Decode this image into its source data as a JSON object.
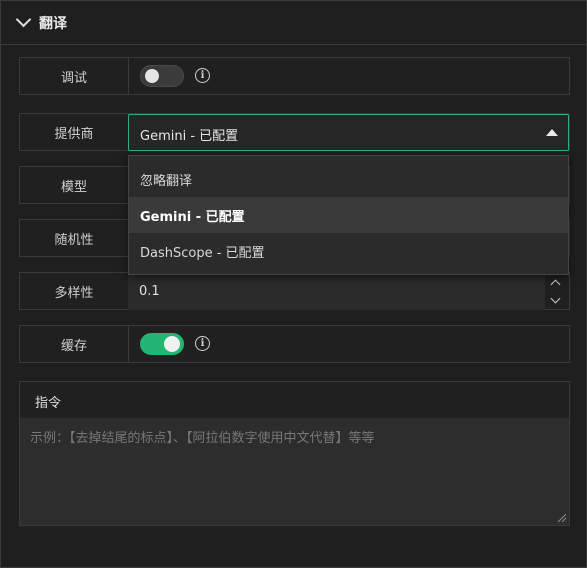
{
  "section": {
    "title": "翻译"
  },
  "debug": {
    "label": "调试",
    "enabled": false
  },
  "provider": {
    "label": "提供商",
    "selected": "Gemini - 已配置",
    "options": [
      {
        "label": "忽略翻译",
        "selected": false
      },
      {
        "label": "Gemini - 已配置",
        "selected": true
      },
      {
        "label": "DashScope - 已配置",
        "selected": false
      }
    ]
  },
  "model": {
    "label": "模型"
  },
  "randomness": {
    "label": "随机性"
  },
  "diversity": {
    "label": "多样性",
    "value": "0.1"
  },
  "cache": {
    "label": "缓存",
    "enabled": true
  },
  "instructions": {
    "label": "指令",
    "placeholder": "示例：【去掉结尾的标点】、【阿拉伯数字使用中文代替】等等"
  },
  "colors": {
    "accent": "#22b573",
    "focus_border": "#2fae7a",
    "background": "#1f1f1f"
  }
}
